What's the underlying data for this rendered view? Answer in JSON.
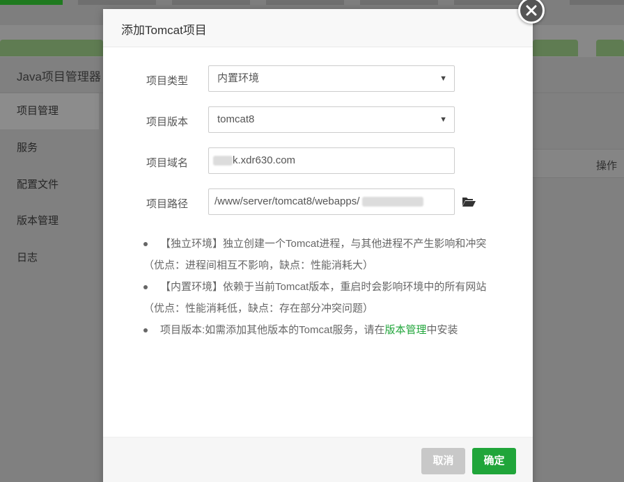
{
  "background": {
    "panel_title": "Java项目管理器",
    "sidebar_items": [
      "项目管理",
      "服务",
      "配置文件",
      "版本管理",
      "日志"
    ],
    "table_header_action": "操作"
  },
  "modal": {
    "title": "添加Tomcat项目",
    "fields": {
      "project_type": {
        "label": "项目类型",
        "value": "内置环境"
      },
      "project_version": {
        "label": "项目版本",
        "value": "tomcat8"
      },
      "project_domain": {
        "label": "项目域名",
        "value": "k.xdr630.com"
      },
      "project_path": {
        "label": "项目路径",
        "value": "/www/server/tomcat8/webapps/"
      }
    },
    "tips": [
      {
        "line1": "【独立环境】独立创建一个Tomcat进程，与其他进程不产生影响和冲突",
        "line2": "（优点：进程间相互不影响，缺点：性能消耗大）"
      },
      {
        "line1": "【内置环境】依赖于当前Tomcat版本，重启时会影响环境中的所有网站",
        "line2": "（优点：性能消耗低，缺点：存在部分冲突问题）"
      },
      {
        "prefix": "项目版本:如需添加其他版本的Tomcat服务，请在",
        "link": "版本管理",
        "suffix": "中安装"
      }
    ],
    "buttons": {
      "cancel": "取消",
      "confirm": "确定"
    }
  },
  "colors": {
    "accent": "#20a53a",
    "cancel": "#c8c8c8"
  },
  "icons": {
    "close": "close-icon",
    "folder": "folder-open-icon",
    "select_caret": "caret-down-icon"
  }
}
